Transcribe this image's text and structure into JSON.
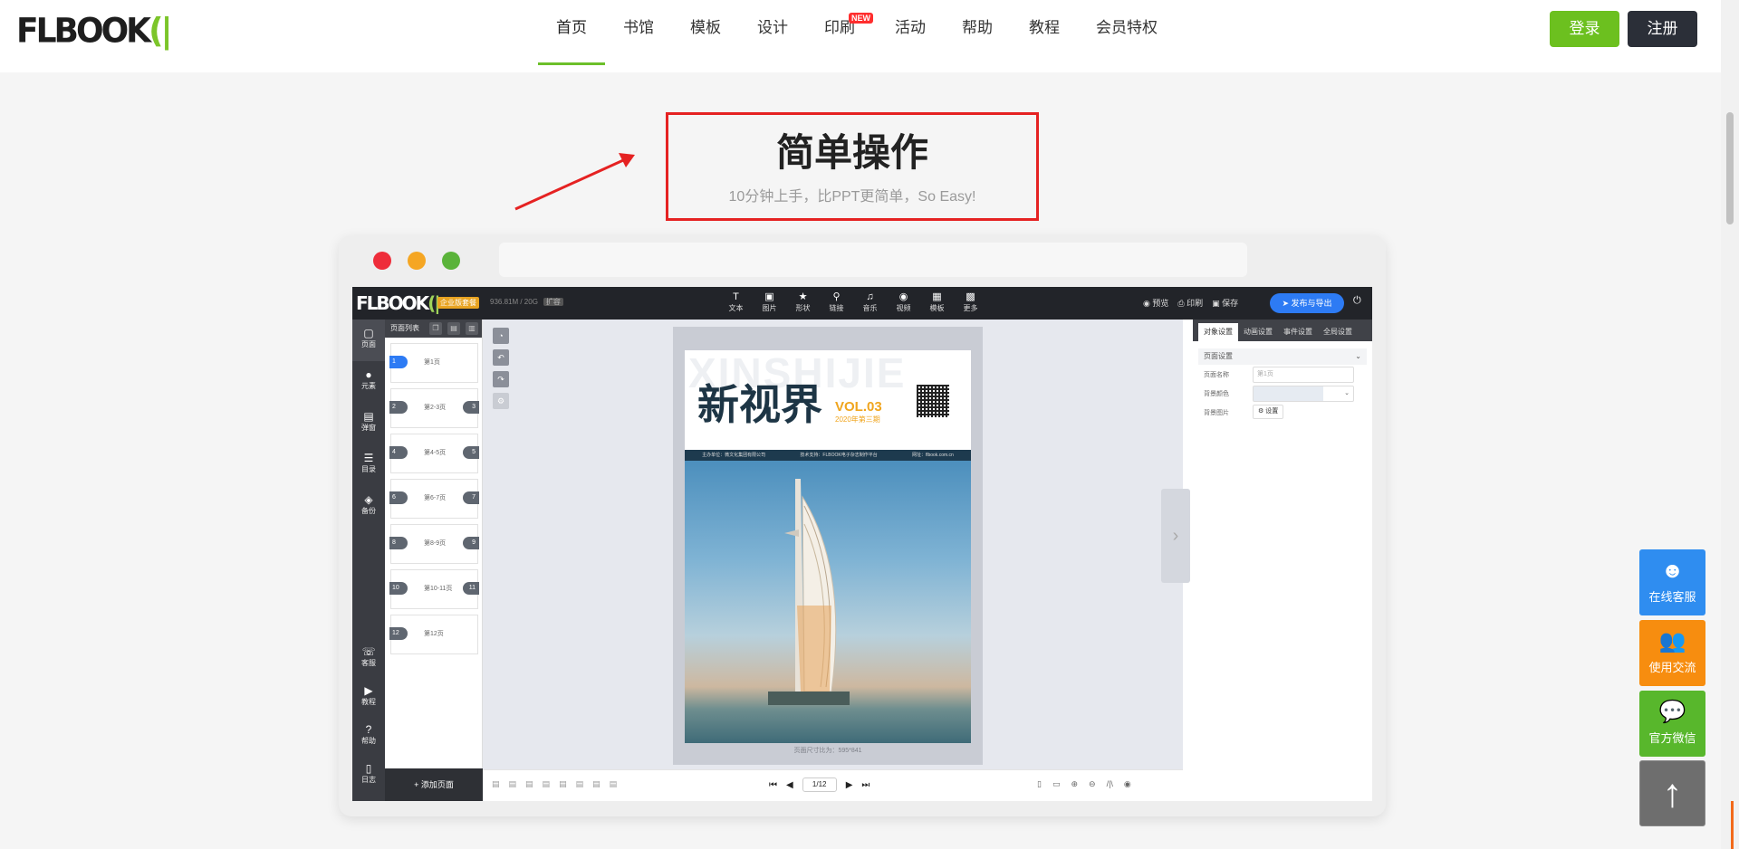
{
  "logo": {
    "text": "FLBOOK",
    "mark": "(|"
  },
  "nav": {
    "items": [
      "首页",
      "书馆",
      "模板",
      "设计",
      "印刷",
      "活动",
      "帮助",
      "教程",
      "会员特权"
    ],
    "new_badge": "NEW"
  },
  "auth": {
    "login": "登录",
    "register": "注册"
  },
  "hero": {
    "title": "简单操作",
    "subtitle": "10分钟上手，比PPT更简单，So Easy!"
  },
  "editor": {
    "logo": "FLBOOK",
    "edition_badge": "企业版套餐",
    "storage": "936.81M / 20G",
    "storage_tag": "扩容",
    "tools": [
      {
        "icon": "text-icon",
        "glyph": "T",
        "label": "文本"
      },
      {
        "icon": "image-icon",
        "glyph": "▣",
        "label": "图片"
      },
      {
        "icon": "shape-icon",
        "glyph": "★",
        "label": "形状"
      },
      {
        "icon": "link-icon",
        "glyph": "⚲",
        "label": "链接"
      },
      {
        "icon": "music-icon",
        "glyph": "♫",
        "label": "音乐"
      },
      {
        "icon": "video-icon",
        "glyph": "◉",
        "label": "视频"
      },
      {
        "icon": "template-icon",
        "glyph": "▦",
        "label": "模板"
      },
      {
        "icon": "more-icon",
        "glyph": "▩",
        "label": "更多"
      }
    ],
    "actions": {
      "preview": "预览",
      "print": "印刷",
      "save": "保存",
      "publish": "发布与导出"
    },
    "left_nav": [
      {
        "icon": "page-icon",
        "glyph": "▢",
        "label": "页面"
      },
      {
        "icon": "element-icon",
        "glyph": "●",
        "label": "元素"
      },
      {
        "icon": "popup-icon",
        "glyph": "▤",
        "label": "弹窗"
      },
      {
        "icon": "toc-icon",
        "glyph": "☰",
        "label": "目录"
      },
      {
        "icon": "backup-icon",
        "glyph": "◈",
        "label": "备份"
      }
    ],
    "left_nav_bottom": [
      {
        "icon": "service-icon",
        "glyph": "☏",
        "label": "客服"
      },
      {
        "icon": "tutorial-icon",
        "glyph": "▶",
        "label": "教程"
      },
      {
        "icon": "help-icon",
        "glyph": "?",
        "label": "帮助"
      },
      {
        "icon": "log-icon",
        "glyph": "▯",
        "label": "日志"
      }
    ],
    "pages_panel": {
      "title": "页面列表",
      "pages": [
        {
          "l": "1",
          "r": "",
          "label": "第1页"
        },
        {
          "l": "2",
          "r": "3",
          "label": "第2-3页"
        },
        {
          "l": "4",
          "r": "5",
          "label": "第4-5页"
        },
        {
          "l": "6",
          "r": "7",
          "label": "第6-7页"
        },
        {
          "l": "8",
          "r": "9",
          "label": "第8-9页"
        },
        {
          "l": "10",
          "r": "11",
          "label": "第10-11页"
        },
        {
          "l": "12",
          "r": "",
          "label": "第12页"
        }
      ],
      "add_page": "+ 添加页面"
    },
    "cover": {
      "ghost": "XINSHIJIE",
      "title": "新视界",
      "vol": "VOL.03",
      "issue": "2020年第三期",
      "band": [
        "主办单位：微文化集团有限公司",
        "技术支持：FLBOOK电子杂志制作平台",
        "网址：flbook.com.cn"
      ]
    },
    "paper_footer": "页面尺寸比为：595*841",
    "pager": {
      "current": "1/12"
    },
    "right_panel": {
      "tabs": [
        "对象设置",
        "动画设置",
        "事件设置",
        "全局设置"
      ],
      "section": "页面设置",
      "page_name_label": "页面名称",
      "page_name_placeholder": "第1页",
      "bg_color_label": "背景颜色",
      "bg_image_label": "背景图片",
      "bg_image_button": "设置"
    }
  },
  "floating": {
    "service": "在线客服",
    "exchange": "使用交流",
    "wechat": "官方微信"
  }
}
